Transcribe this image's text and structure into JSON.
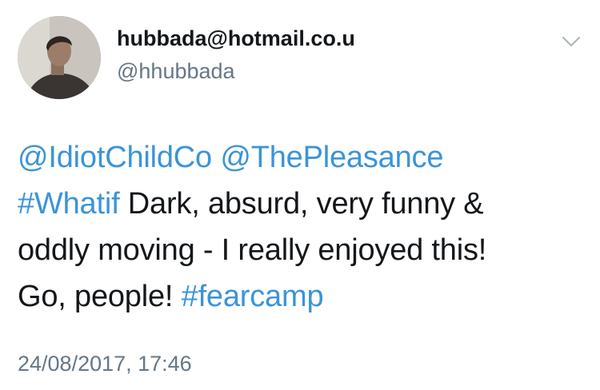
{
  "author": {
    "display_name": "hubbada@hotmail.co.u",
    "handle": "@hhubbada",
    "avatar_icon": "profile-photo"
  },
  "menu": {
    "icon": "chevron-down-icon"
  },
  "tweet": {
    "mention_1": "@IdiotChildCo",
    "space_1": " ",
    "mention_2": "@ThePleasance",
    "hashtag_1": "#Whatif",
    "text_1": " Dark, absurd, very funny &",
    "text_2": "oddly moving - I really enjoyed this!",
    "text_3": "Go, people! ",
    "hashtag_2": "#fearcamp"
  },
  "timestamp": "24/08/2017, 17:46",
  "colors": {
    "link": "#3b94d9",
    "muted": "#657786",
    "text": "#14171a"
  }
}
